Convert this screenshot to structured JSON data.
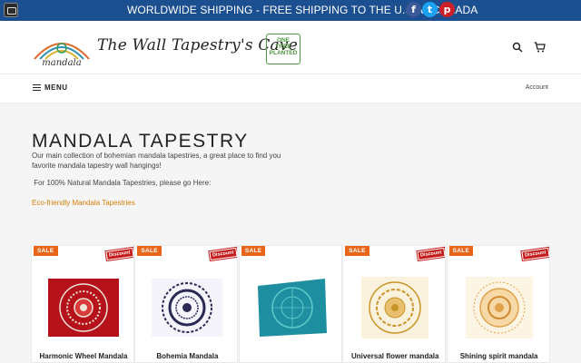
{
  "topbar": {
    "announcement": "WORLDWIDE SHIPPING - FREE SHIPPING TO THE U.S.A / CANADA",
    "social": [
      {
        "name": "facebook",
        "glyph": "f",
        "color": "#3b5998"
      },
      {
        "name": "twitter",
        "glyph": "t",
        "color": "#1da1f2"
      },
      {
        "name": "pinterest",
        "glyph": "p",
        "color": "#cb2027"
      }
    ],
    "background": "#1b4f8f"
  },
  "header": {
    "logo_small_text": "mandala",
    "store_name": "The Wall Tapestry's Cave",
    "badge_lines": [
      "ONE",
      "TREE",
      "PLANTED"
    ],
    "badge_color": "#4c9a3f"
  },
  "nav": {
    "menu_label": "MENU",
    "account_label": "Account"
  },
  "collection": {
    "title": "MANDALA TAPESTRY",
    "description": "Our main collection of bohemian mandala tapestries, a great place to find you favorite mandala tapestry wall hangings!",
    "natural_note": " For 100% Natural Mandala Tapestries, please go Here:",
    "eco_link": "Eco-friendly Mandala Tapestries",
    "link_color": "#d9800b"
  },
  "products": [
    {
      "name": "Harmonic Wheel Mandala",
      "sale": "SALE",
      "discount": "Discount",
      "palette": [
        "#b5121b",
        "#f0e6d6"
      ]
    },
    {
      "name": "Bohemia Mandala",
      "sale": "SALE",
      "discount": "Discount",
      "palette": [
        "#2a2a55",
        "#ffffff"
      ]
    },
    {
      "name": "",
      "sale": "SALE",
      "discount": "",
      "palette": [
        "#1e8fa0",
        "#5fc9c9"
      ]
    },
    {
      "name": "Universal flower mandala",
      "sale": "SALE",
      "discount": "Discount",
      "palette": [
        "#c8952a",
        "#fbf2dd"
      ]
    },
    {
      "name": "Shining spirit mandala",
      "sale": "SALE",
      "discount": "Discount",
      "palette": [
        "#e0a24a",
        "#fdf5e3"
      ]
    }
  ],
  "sale_color": "#e8651a"
}
